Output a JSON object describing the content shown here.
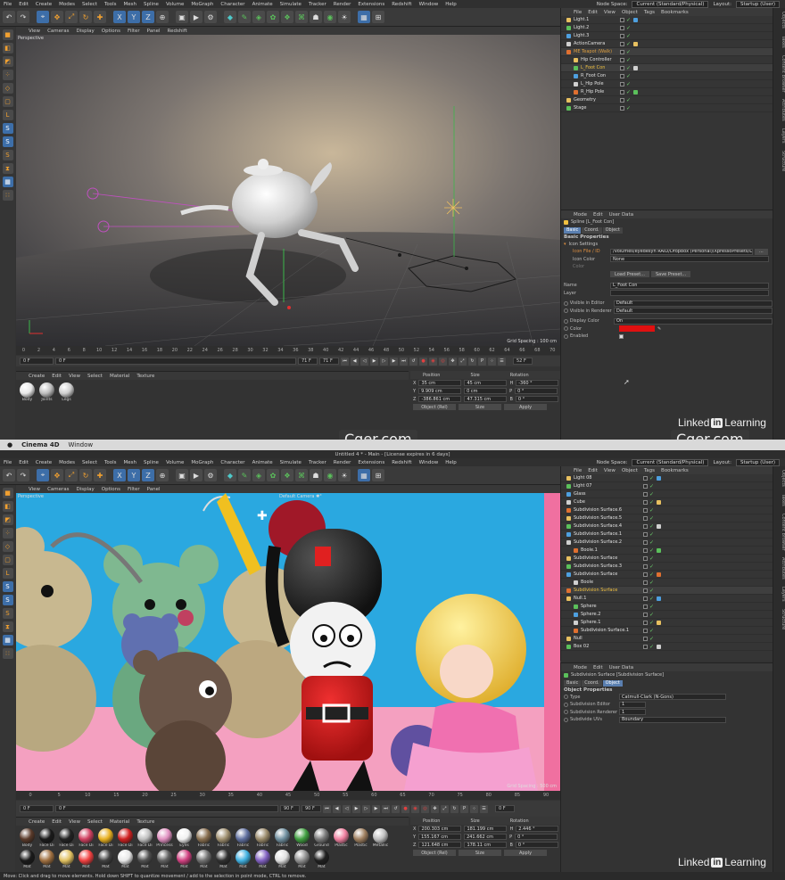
{
  "top": {
    "menu": [
      "File",
      "Edit",
      "Create",
      "Modes",
      "Select",
      "Tools",
      "Mesh",
      "Spline",
      "Volume",
      "MoGraph",
      "Character",
      "Animate",
      "Simulate",
      "Tracker",
      "Render",
      "Extensions",
      "Redshift",
      "Window",
      "Help"
    ],
    "node_space_label": "Node Space:",
    "node_space_value": "Current (Standard/Physical)",
    "layout_label": "Layout:",
    "layout_value": "Startup (User)",
    "viewport_menu": [
      "View",
      "Cameras",
      "Display",
      "Options",
      "Filter",
      "Panel",
      "Redshift"
    ],
    "viewport_label": "Perspective",
    "grid_spacing": "Grid Spacing : 100 cm",
    "timeline_ticks": [
      "0",
      "2",
      "4",
      "6",
      "8",
      "10",
      "12",
      "14",
      "16",
      "18",
      "20",
      "22",
      "24",
      "26",
      "28",
      "30",
      "32",
      "34",
      "36",
      "38",
      "40",
      "42",
      "44",
      "46",
      "48",
      "50",
      "52",
      "54",
      "56",
      "58",
      "60",
      "62",
      "64",
      "66",
      "68",
      "70"
    ],
    "current_frame_left": "0 F",
    "current_frame_left2": "0 F",
    "end_frame": "71 F",
    "end_frame2": "71 F",
    "frame_readout": "52 F",
    "materials_menu": [
      "Create",
      "Edit",
      "View",
      "Select",
      "Material",
      "Texture"
    ],
    "materials": [
      {
        "label": "Body",
        "color": "#e8e8e8"
      },
      {
        "label": "Joints",
        "color": "#bdbdbd"
      },
      {
        "label": "Legs",
        "color": "#cfcfcf"
      }
    ],
    "coord_headers": [
      "Position",
      "Size",
      "Rotation"
    ],
    "coords": [
      {
        "axis": "X",
        "pos": "35 cm",
        "size": "45 cm",
        "rot_axis": "H",
        "rot": "-360 °"
      },
      {
        "axis": "Y",
        "pos": "9.909 cm",
        "size": "0 cm",
        "rot_axis": "P",
        "rot": "0 °"
      },
      {
        "axis": "Z",
        "pos": "-386.861 cm",
        "size": "47.315 cm",
        "rot_axis": "B",
        "rot": "0 °"
      }
    ],
    "coord_mode": "Object (Rel)",
    "coord_size": "Size",
    "apply": "Apply",
    "om_menu": [
      "File",
      "Edit",
      "View",
      "Object",
      "Tags",
      "Bookmarks"
    ],
    "objects": [
      {
        "name": "Light.1",
        "indent": 0,
        "color": "#e0e0e0"
      },
      {
        "name": "Light.2",
        "indent": 0,
        "color": "#e0e0e0"
      },
      {
        "name": "Light.3",
        "indent": 0,
        "color": "#e0e0e0"
      },
      {
        "name": "ActionCamera",
        "indent": 0,
        "color": "#e0e0e0"
      },
      {
        "name": "ME Teapot (Walk)",
        "indent": 0,
        "color": "#e0a040"
      },
      {
        "name": "Hip Controller",
        "indent": 1,
        "color": "#e0e0e0"
      },
      {
        "name": "L_Foot Con",
        "indent": 1,
        "color": "#f0c040"
      },
      {
        "name": "R_Foot Con",
        "indent": 1,
        "color": "#e0e0e0"
      },
      {
        "name": "L_Hip Pole",
        "indent": 1,
        "color": "#e0e0e0"
      },
      {
        "name": "R_Hip Pole",
        "indent": 1,
        "color": "#e0e0e0"
      },
      {
        "name": "Geometry",
        "indent": 0,
        "color": "#e0e0e0"
      },
      {
        "name": "Stage",
        "indent": 0,
        "color": "#e0e0e0"
      }
    ],
    "attr_menu": [
      "Mode",
      "Edit",
      "User Data"
    ],
    "attr_title": "Spline [L_Foot Con]",
    "attr_tabs": [
      "Basic",
      "Coord.",
      "Object"
    ],
    "attr_section": "Basic Properties",
    "icon_settings": "Icon Settings",
    "icon_file_label": "Icon File / ID",
    "icon_file_value": "/Volumes/eyedesyn RAID/Dropbox (Personal)/XpressoPresets/Light",
    "icon_color_label": "Icon Color",
    "icon_color_value": "None",
    "color_label_small": "Color",
    "load_preset": "Load Preset...",
    "save_preset": "Save Preset...",
    "name_label": "Name",
    "name_value": "L_Foot Con",
    "layer_label": "Layer",
    "vis_editor_label": "Visible in Editor",
    "vis_editor_value": "Default",
    "vis_render_label": "Visible in Renderer",
    "vis_render_value": "Default",
    "display_color_label": "Display Color",
    "display_color_value": "On",
    "color_label": "Color",
    "color_value": "#e01010",
    "enabled_label": "Enabled",
    "side_tabs": [
      "Objects",
      "Takes",
      "Content Browser",
      "Attributes",
      "Layers",
      "Structure"
    ]
  },
  "mac": {
    "app": "Cinema 4D",
    "window": "Window"
  },
  "watermarks": [
    "Cger.com",
    "Cger.com"
  ],
  "linkedin": {
    "brand": "Linked",
    "in": "in",
    "learning": "Learning"
  },
  "bottom": {
    "title": "Untitled 4 * - Main - [License expires in 6 days]",
    "menu": [
      "File",
      "Edit",
      "Create",
      "Modes",
      "Select",
      "Tools",
      "Mesh",
      "Spline",
      "Volume",
      "MoGraph",
      "Character",
      "Animate",
      "Simulate",
      "Tracker",
      "Render",
      "Extensions",
      "Redshift",
      "Window",
      "Help"
    ],
    "node_space_label": "Node Space:",
    "node_space_value": "Current (Standard/Physical)",
    "layout_label": "Layout:",
    "layout_value": "Startup (User)",
    "viewport_menu": [
      "View",
      "Cameras",
      "Display",
      "Options",
      "Filter",
      "Panel"
    ],
    "viewport_label": "Perspective",
    "camera_label": "Default Camera ✱°",
    "grid_spacing": "Grid Spacing : 500 cm",
    "timeline_ticks": [
      "0",
      "5",
      "10",
      "15",
      "20",
      "25",
      "30",
      "35",
      "40",
      "45",
      "50",
      "55",
      "60",
      "65",
      "70",
      "75",
      "80",
      "85",
      "90"
    ],
    "frame_a": "0 F",
    "frame_b": "0 F",
    "frame_c": "90 F",
    "frame_d": "90 F",
    "frame_readout": "0 F",
    "materials_menu": [
      "Create",
      "Edit",
      "View",
      "Select",
      "Material",
      "Texture"
    ],
    "materials": [
      {
        "label": "Body",
        "color": "#5a3a2a"
      },
      {
        "label": "Face Di",
        "color": "#1a1a1a"
      },
      {
        "label": "Face Di",
        "color": "#222"
      },
      {
        "label": "Face Di",
        "color": "#d04060"
      },
      {
        "label": "Face Di",
        "color": "#e8b020"
      },
      {
        "label": "Face Di",
        "color": "#d02020"
      },
      {
        "label": "Face Di",
        "color": "#c0c0c0"
      },
      {
        "label": "Princess",
        "color": "#e090c0"
      },
      {
        "label": "Eyes",
        "color": "#f0f0f0"
      },
      {
        "label": "Fabric",
        "color": "#8a7050"
      },
      {
        "label": "Fabric",
        "color": "#a09070"
      },
      {
        "label": "Fabric",
        "color": "#6070a0"
      },
      {
        "label": "Fabric",
        "color": "#9a8a6a"
      },
      {
        "label": "Fabric",
        "color": "#7090a0"
      },
      {
        "label": "Wood",
        "color": "#40a040"
      },
      {
        "label": "Ground",
        "color": "#7a7a7a"
      },
      {
        "label": "Plastic",
        "color": "#f080a0"
      },
      {
        "label": "Plastic",
        "color": "#a08060"
      },
      {
        "label": "Metallic",
        "color": "#c0c0c0"
      },
      {
        "label": "Mat",
        "color": "#1a1a1a"
      },
      {
        "label": "Mat",
        "color": "#a07040"
      },
      {
        "label": "Mat",
        "color": "#e0c060"
      },
      {
        "label": "Mat",
        "color": "#f04040"
      },
      {
        "label": "Mat",
        "color": "#404040"
      },
      {
        "label": "Mat",
        "color": "#e8e8e8"
      },
      {
        "label": "Mat",
        "color": "#505050"
      },
      {
        "label": "Mat",
        "color": "#606060"
      },
      {
        "label": "Mat",
        "color": "#d04080"
      },
      {
        "label": "Mat",
        "color": "#707070"
      },
      {
        "label": "Mat",
        "color": "#303030"
      },
      {
        "label": "Mat",
        "color": "#40b0e0"
      },
      {
        "label": "Mat",
        "color": "#8060c0"
      },
      {
        "label": "Mat",
        "color": "#e0e0e0"
      },
      {
        "label": "Mat",
        "color": "#909090"
      },
      {
        "label": "Mat",
        "color": "#202020"
      }
    ],
    "coord_headers": [
      "Position",
      "Size",
      "Rotation"
    ],
    "coords": [
      {
        "axis": "X",
        "pos": "200.303 cm",
        "size": "181.199 cm",
        "rot_axis": "H",
        "rot": "2.446 °"
      },
      {
        "axis": "Y",
        "pos": "155.167 cm",
        "size": "241.662 cm",
        "rot_axis": "P",
        "rot": "0 °"
      },
      {
        "axis": "Z",
        "pos": "121.648 cm",
        "size": "178.11 cm",
        "rot_axis": "B",
        "rot": "0 °"
      }
    ],
    "coord_mode": "Object (Rel)",
    "coord_size": "Size",
    "apply": "Apply",
    "om_menu": [
      "File",
      "Edit",
      "View",
      "Object",
      "Tags",
      "Bookmarks"
    ],
    "objects": [
      {
        "name": "Light 08",
        "indent": 0,
        "color": "#e0e0e0"
      },
      {
        "name": "Light 07",
        "indent": 0,
        "color": "#e0e0e0"
      },
      {
        "name": "Glass",
        "indent": 0,
        "color": "#e0e0e0"
      },
      {
        "name": "Cube",
        "indent": 0,
        "color": "#e0e0e0"
      },
      {
        "name": "Subdivision Surface.6",
        "indent": 0,
        "color": "#e0e0e0"
      },
      {
        "name": "Subdivision Surface.5",
        "indent": 0,
        "color": "#e0e0e0"
      },
      {
        "name": "Subdivision Surface.4",
        "indent": 0,
        "color": "#e0e0e0"
      },
      {
        "name": "Subdivision Surface.1",
        "indent": 0,
        "color": "#e0e0e0"
      },
      {
        "name": "Subdivision Surface.2",
        "indent": 0,
        "color": "#e0e0e0"
      },
      {
        "name": "Boole.1",
        "indent": 1,
        "color": "#e0e0e0"
      },
      {
        "name": "Subdivision Surface",
        "indent": 0,
        "color": "#e0e0e0"
      },
      {
        "name": "Subdivision Surface.3",
        "indent": 0,
        "color": "#e0e0e0"
      },
      {
        "name": "Subdivision Surface",
        "indent": 0,
        "color": "#e0e0e0"
      },
      {
        "name": "Boole",
        "indent": 1,
        "color": "#e0e0e0"
      },
      {
        "name": "Subdivision Surface",
        "indent": 0,
        "color": "#f0c040"
      },
      {
        "name": "Null.1",
        "indent": 0,
        "color": "#e0e0e0"
      },
      {
        "name": "Sphere",
        "indent": 1,
        "color": "#e0e0e0"
      },
      {
        "name": "Sphere.2",
        "indent": 1,
        "color": "#e0e0e0"
      },
      {
        "name": "Sphere.1",
        "indent": 1,
        "color": "#e0e0e0"
      },
      {
        "name": "Subdivision Surface.1",
        "indent": 1,
        "color": "#e0e0e0"
      },
      {
        "name": "Null",
        "indent": 0,
        "color": "#e0e0e0"
      },
      {
        "name": "Box 02",
        "indent": 0,
        "color": "#e0e0e0"
      }
    ],
    "attr_menu": [
      "Mode",
      "Edit",
      "User Data"
    ],
    "attr_title": "Subdivision Surface [Subdivision Surface]",
    "attr_tabs": [
      "Basic",
      "Coord.",
      "Object"
    ],
    "attr_section": "Object Properties",
    "type_label": "Type",
    "type_value": "Catmull-Clark (N-Gons)",
    "sub_editor_label": "Subdivision Editor",
    "sub_editor_value": "1",
    "sub_render_label": "Subdivision Renderer",
    "sub_render_value": "1",
    "sub_uvs_label": "Subdivide UVs",
    "sub_uvs_value": "Boundary",
    "side_tabs": [
      "Objects",
      "Takes",
      "Content Browser",
      "Attributes",
      "Layers",
      "Structure"
    ],
    "status": "Move: Click and drag to move elements. Hold down SHIFT to quantize movement / add to the selection in point mode, CTRL to remove."
  }
}
